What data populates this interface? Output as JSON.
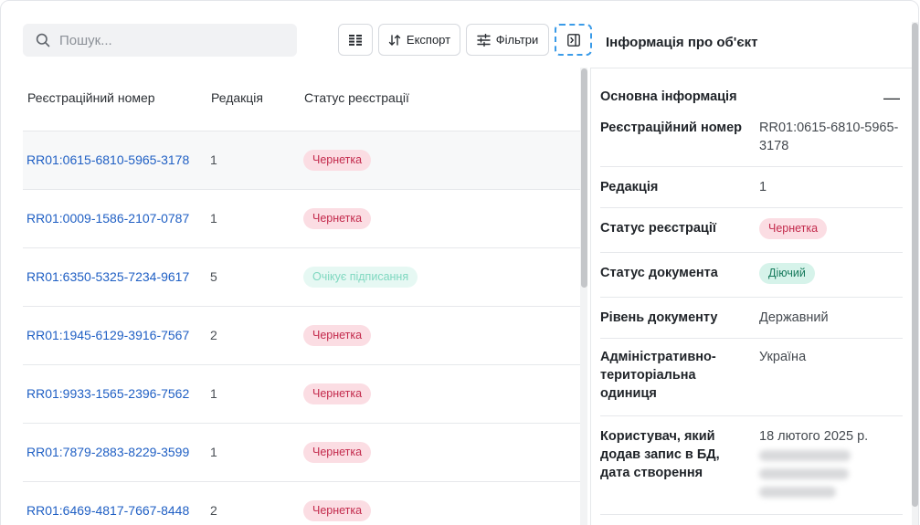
{
  "search": {
    "placeholder": "Пошук..."
  },
  "toolbar": {
    "export_label": "Експорт",
    "filters_label": "Фільтри"
  },
  "panel_title": "Інформація про об'єкт",
  "table": {
    "headers": [
      "Реєстраційний номер",
      "Редакція",
      "Статус реєстрації"
    ],
    "rows": [
      {
        "number": "RR01:0615-6810-5965-3178",
        "edition": "1",
        "status": "Чернетка",
        "kind": "draft"
      },
      {
        "number": "RR01:0009-1586-2107-0787",
        "edition": "1",
        "status": "Чернетка",
        "kind": "draft"
      },
      {
        "number": "RR01:6350-5325-7234-9617",
        "edition": "5",
        "status": "Очікує підписання",
        "kind": "await"
      },
      {
        "number": "RR01:1945-6129-3916-7567",
        "edition": "2",
        "status": "Чернетка",
        "kind": "draft"
      },
      {
        "number": "RR01:9933-1565-2396-7562",
        "edition": "1",
        "status": "Чернетка",
        "kind": "draft"
      },
      {
        "number": "RR01:7879-2883-8229-3599",
        "edition": "1",
        "status": "Чернетка",
        "kind": "draft"
      },
      {
        "number": "RR01:6469-4817-7667-8448",
        "edition": "2",
        "status": "Чернетка",
        "kind": "draft"
      }
    ]
  },
  "details": {
    "section_title": "Основна інформація",
    "collapse_symbol": "—",
    "fields": [
      {
        "label": "Реєстраційний номер",
        "value": "RR01:0615-6810-5965-3178"
      },
      {
        "label": "Редакція",
        "value": "1"
      },
      {
        "label": "Статус реєстрації",
        "value": "Чернетка"
      },
      {
        "label": "Статус документа",
        "value": "Діючий"
      },
      {
        "label": "Рівень документу",
        "value": "Державний"
      },
      {
        "label": "Адміністративно-територіальна одиниця",
        "value": "Україна"
      },
      {
        "label": "Користувач, який додав запис в БД, дата створення",
        "value": "18 лютого 2025 р."
      }
    ]
  },
  "colors": {
    "link": "#1f5fc4",
    "draft_bg": "#fbdde3",
    "draft_fg": "#c32a4c",
    "active_bg": "#d6f3ea",
    "active_fg": "#167a5c",
    "focus": "#3a9be8"
  }
}
